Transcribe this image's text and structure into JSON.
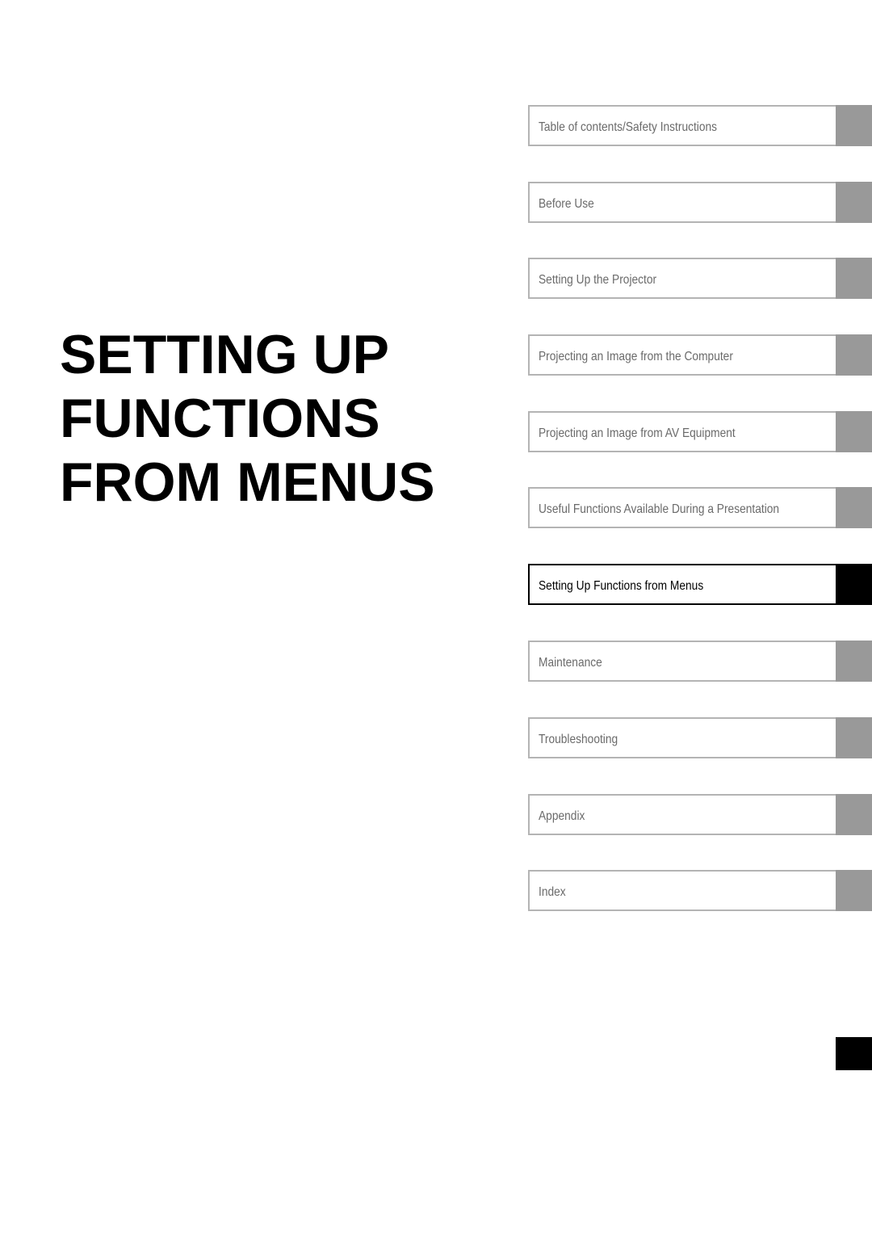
{
  "page": {
    "title_lines": [
      "SETTING UP",
      "FUNCTIONS",
      "FROM MENUS"
    ]
  },
  "nav": {
    "items": [
      {
        "label": "Table of contents/Safety Instructions",
        "active": false
      },
      {
        "label": "Before Use",
        "active": false
      },
      {
        "label": "Setting Up the Projector",
        "active": false
      },
      {
        "label": "Projecting an Image from the Computer",
        "active": false
      },
      {
        "label": "Projecting an Image from AV Equipment",
        "active": false
      },
      {
        "label": "Useful Functions Available During a Presentation",
        "active": false
      },
      {
        "label": "Setting Up Functions from Menus",
        "active": true
      },
      {
        "label": "Maintenance",
        "active": false
      },
      {
        "label": "Troubleshooting",
        "active": false
      },
      {
        "label": "Appendix",
        "active": false
      },
      {
        "label": "Index",
        "active": false
      }
    ]
  },
  "colors": {
    "tab_inactive": "#999999",
    "tab_active": "#000000",
    "border_inactive": "#b4b4b4",
    "text_inactive": "#6a6a6a"
  }
}
